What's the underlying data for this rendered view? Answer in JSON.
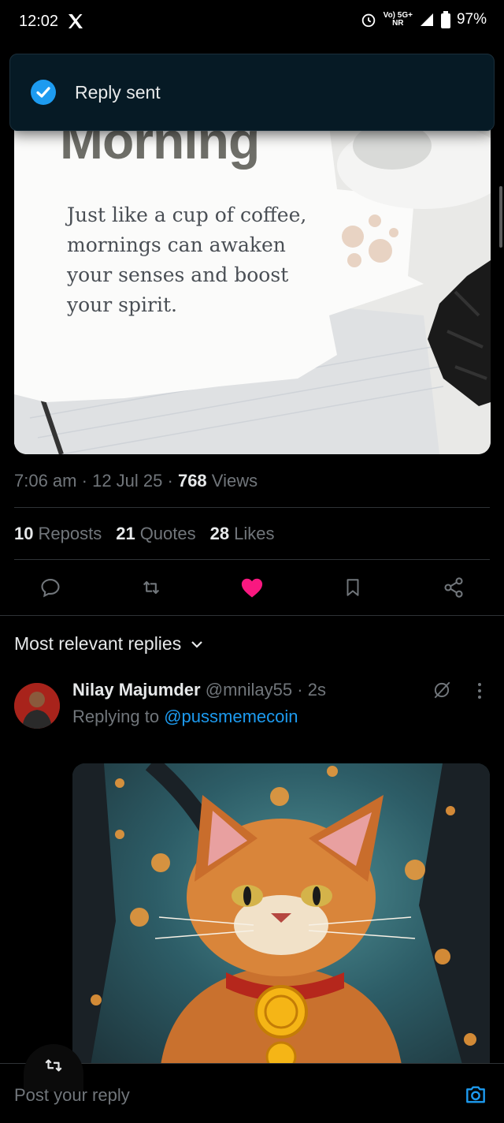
{
  "status_bar": {
    "time": "12:02",
    "network_top": "Vo) 5G+",
    "network_bottom": "NR",
    "battery": "97%"
  },
  "toast": {
    "text": "Reply sent"
  },
  "tweet": {
    "image": {
      "title": "Morning",
      "body": "Just like a cup of coffee, mornings can awaken your senses and boost your spirit."
    },
    "time": "7:06 am",
    "date": "12 Jul 25",
    "views_count": "768",
    "views_label": "Views",
    "reposts_count": "10",
    "reposts_label": "Reposts",
    "quotes_count": "21",
    "quotes_label": "Quotes",
    "likes_count": "28",
    "likes_label": "Likes"
  },
  "replies": {
    "sort_label": "Most relevant replies",
    "items": [
      {
        "name": "Nilay Majumder",
        "handle": "@mnilay55",
        "age": "2s",
        "replying_prefix": "Replying to",
        "replying_to": "@pussmemecoin"
      }
    ]
  },
  "compose": {
    "placeholder": "Post your reply"
  },
  "colors": {
    "accent": "#1d9bf0",
    "like": "#f91880",
    "background": "#000000"
  }
}
